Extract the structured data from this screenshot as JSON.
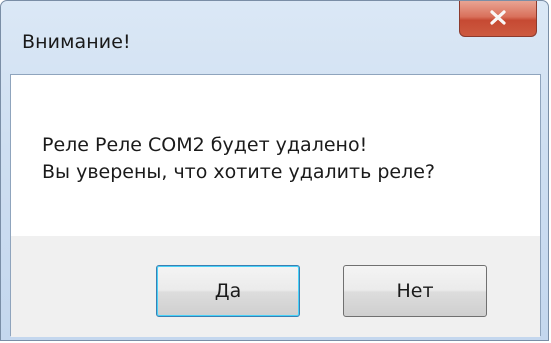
{
  "dialog": {
    "title": "Внимание!",
    "close_icon": "close-icon",
    "message_line1": "Реле Реле COM2 будет удалено!",
    "message_line2": "Вы уверены, что хотите удалить реле?",
    "yes_label": "Да",
    "no_label": "Нет"
  },
  "colors": {
    "close_button": "#c64a33",
    "frame": "#cfdff1",
    "default_button_border": "#3c7fb1"
  }
}
